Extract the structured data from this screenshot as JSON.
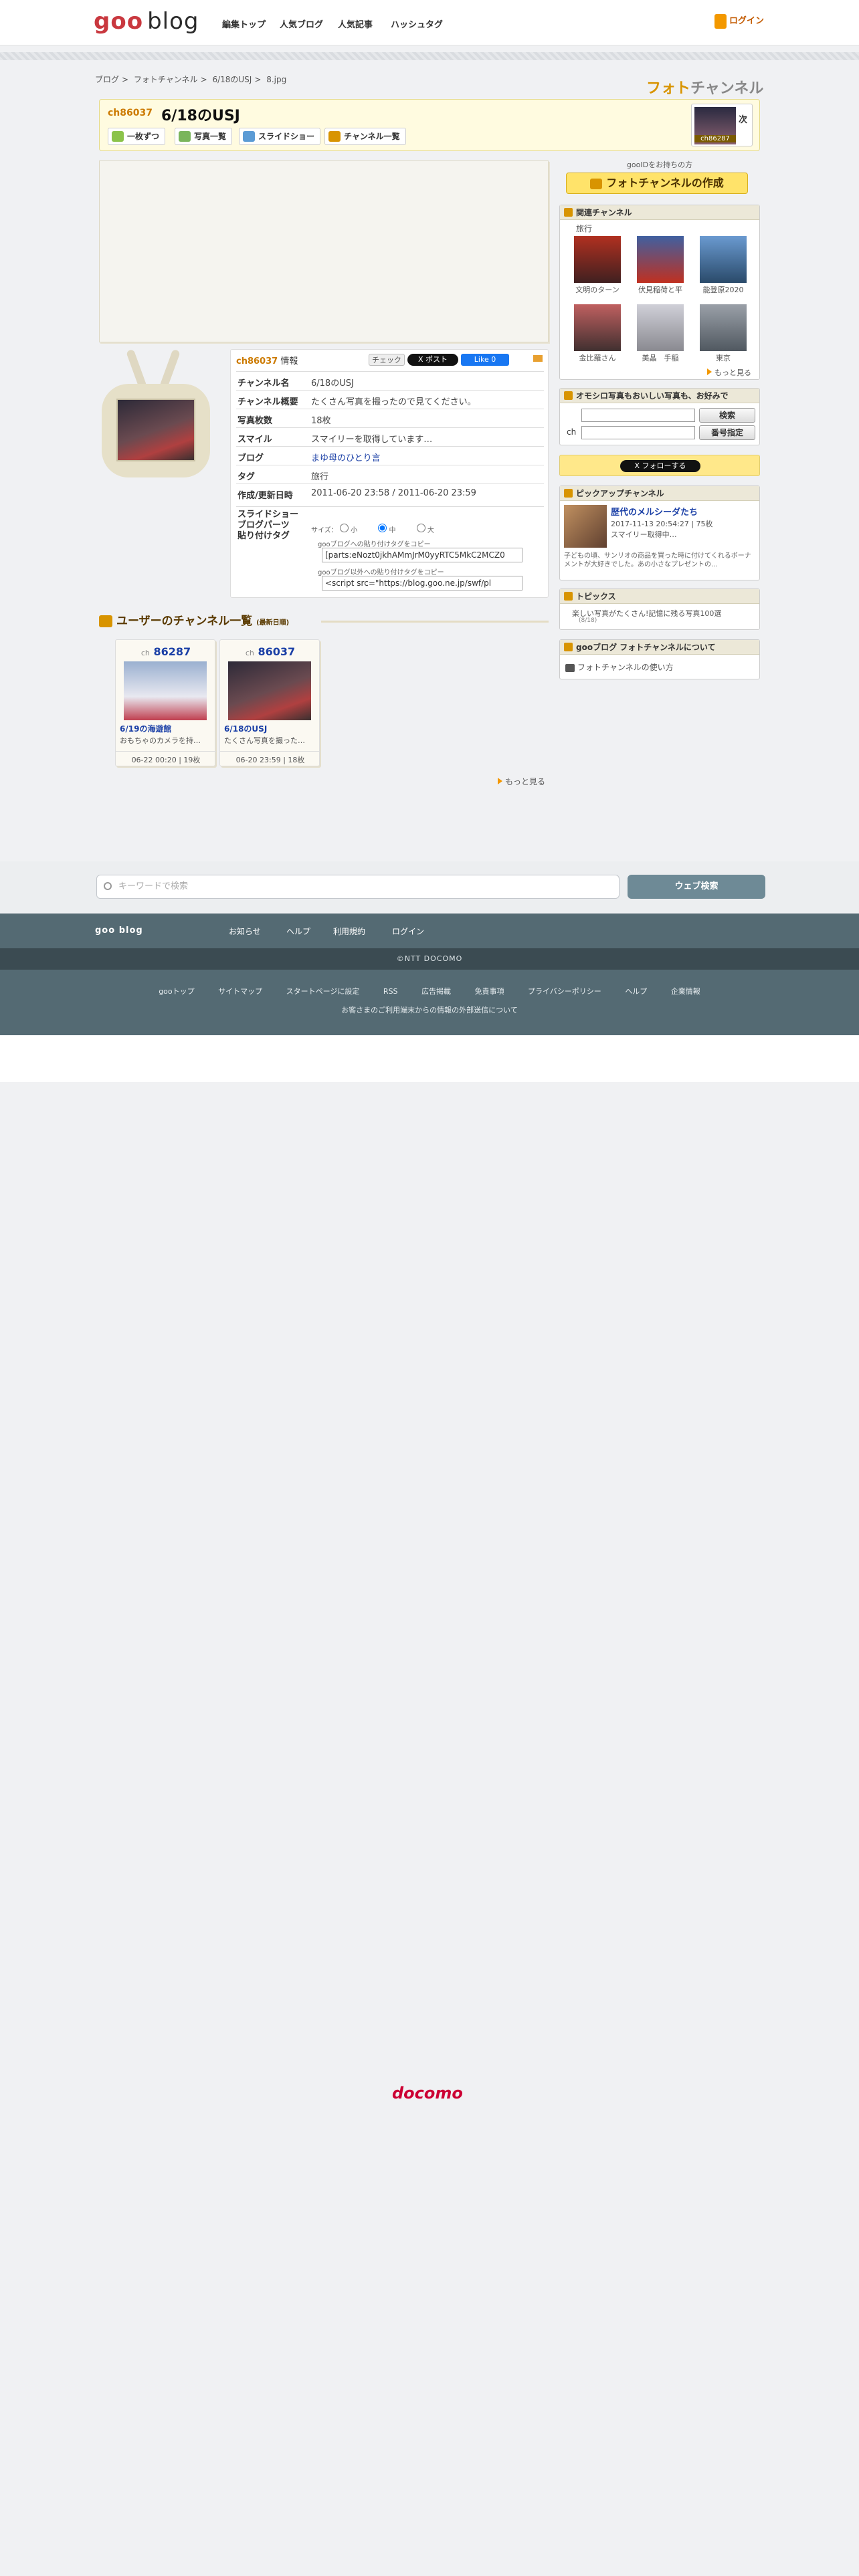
{
  "header": {
    "logo_goo": "goo",
    "logo_blog": "blog",
    "nav": [
      "編集トップ",
      "人気ブログ",
      "人気記事",
      "ハッシュタグ"
    ],
    "login": "ログイン"
  },
  "breadcrumb": [
    "ブログ",
    ">",
    "フォトチャンネル",
    ">",
    "6/18のUSJ",
    ">",
    "8.jpg"
  ],
  "photo_channel_logo": {
    "a": "フォト",
    "b": "チャンネル"
  },
  "channel": {
    "id": "ch86037",
    "title": "6/18のUSJ",
    "buttons": [
      "一枚ずつ",
      "写真一覧",
      "スライドショー",
      "チャンネル一覧"
    ],
    "next_label": "次",
    "next_channel": "ch86287"
  },
  "info": {
    "header_ch": "ch86037",
    "header_suffix": "情報",
    "check_label": "チェック",
    "post_label": "X ポスト",
    "like_label": "Like 0",
    "rows": [
      {
        "k": "チャンネル名",
        "v": "6/18のUSJ"
      },
      {
        "k": "チャンネル概要",
        "v": "たくさん写真を撮ったので見てください。"
      },
      {
        "k": "写真枚数",
        "v": "18枚"
      },
      {
        "k": "スマイル",
        "v": "スマイリーを取得しています…"
      },
      {
        "k": "ブログ",
        "v": "まゆ母のひとり言"
      },
      {
        "k": "タグ",
        "v": "旅行"
      },
      {
        "k": "作成/更新日時",
        "v": "2011-06-20 23:58 / 2011-06-20 23:59"
      }
    ],
    "slideshow_label": "スライドショー",
    "blogparts_label": "ブログパーツ",
    "tag_label": "貼り付けタグ",
    "size_label": "サイズ：",
    "size_options": [
      "小",
      "中",
      "大"
    ],
    "copy1": "gooブログへの貼り付けタグをコピー",
    "tag1": "[parts:eNozt0jkhAMmJrM0yyRTC5MkC2MCZ0",
    "copy2": "gooブログ以外への貼り付けタグをコピー",
    "tag2": "<script src=\"https://blog.goo.ne.jp/swf/pl"
  },
  "user_channels": {
    "title": "ユーザーのチャンネル一覧",
    "subtitle": "(最新日順)",
    "items": [
      {
        "ch_prefix": "ch",
        "ch": "86287",
        "title": "6/19の海遊館",
        "desc": "おもちゃのカメラを持…",
        "meta": "06-22 00:20 | 19枚"
      },
      {
        "ch_prefix": "ch",
        "ch": "86037",
        "title": "6/18のUSJ",
        "desc": "たくさん写真を撮った…",
        "meta": "06-20 23:59 | 18枚"
      }
    ],
    "more": "もっと見る"
  },
  "sidebar": {
    "top_note": "gooIDをお持ちの方",
    "create_button": "フォトチャンネルの作成",
    "related_title": "関連チャンネル",
    "related_cat": "旅行",
    "related": [
      "文明のターン",
      "伏見稲荷と平",
      "能登原2020",
      "金比羅さん",
      "美晶　手稲",
      "東京"
    ],
    "related_more": "もっと見る",
    "search_title": "オモシロ写真もおいしい写真も、お好みで",
    "search_btn": "検索",
    "ch_label": "ch",
    "num_btn": "番号指定",
    "follow": "X フォローする",
    "pickup_title": "ピックアップチャンネル",
    "pickup_name": "歴代のメルシーダたち",
    "pickup_meta": "2017-11-13 20:54:27 | 75枚",
    "pickup_sub": "スマイリー取得中…",
    "pickup_desc": "子どもの頃、サンリオの商品を買った時に付けてくれるボーナメントが大好きでした。あの小さなプレゼントの…",
    "topics_title": "トピックス",
    "topics_item": "楽しい写真がたくさん!記憶に残る写真100選",
    "topics_date": "(8/18)",
    "about_title": "gooブログ フォトチャンネルについて",
    "about_item": "フォトチャンネルの使い方"
  },
  "footer": {
    "search_placeholder": "キーワードで検索",
    "search_btn": "ウェブ検索",
    "brand": "goo blog",
    "links1": [
      "お知らせ",
      "ヘルプ",
      "利用規約",
      "ログイン"
    ],
    "copyright": "©NTT DOCOMO",
    "links2": [
      "gooトップ",
      "サイトマップ",
      "スタートページに設定",
      "RSS",
      "広告掲載",
      "免責事項",
      "プライバシーポリシー",
      "ヘルプ",
      "企業情報"
    ],
    "notice": "お客さまのご利用端末からの情報の外部送信について",
    "docomo": "docomo"
  },
  "colors": {
    "accent": "#f39800",
    "footer": "#546a73",
    "brand_red": "#c9383f"
  }
}
